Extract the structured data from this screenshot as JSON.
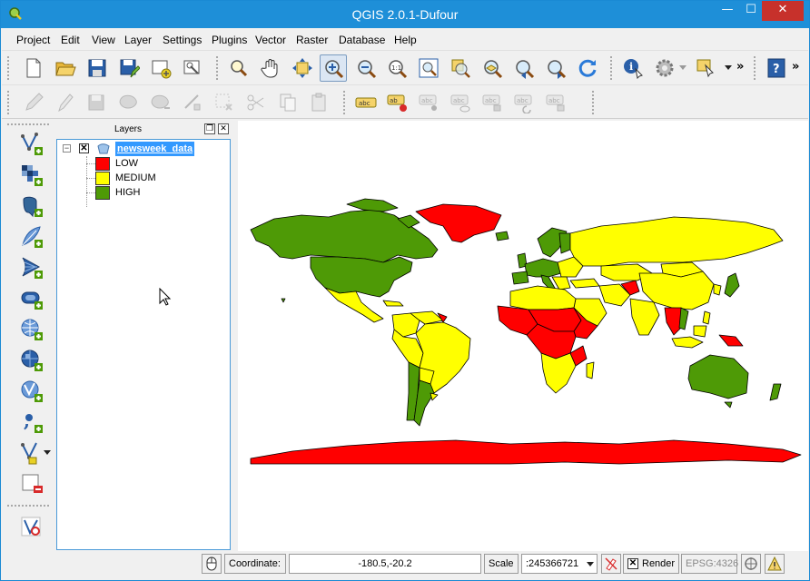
{
  "window": {
    "title": "QGIS 2.0.1-Dufour",
    "minimize": "—",
    "maximize": "☐",
    "close": "✕"
  },
  "menu": [
    {
      "label": "Project"
    },
    {
      "label": "Edit"
    },
    {
      "label": "View"
    },
    {
      "label": "Layer"
    },
    {
      "label": "Settings"
    },
    {
      "label": "Plugins"
    },
    {
      "label": "Vector"
    },
    {
      "label": "Raster"
    },
    {
      "label": "Database"
    },
    {
      "label": "Help"
    }
  ],
  "toolbar1_icons": [
    "new-project-icon",
    "open-project-icon",
    "save-project-icon",
    "save-as-icon",
    "new-print-composer-icon",
    "composer-manager-icon",
    "touch-zoom-icon",
    "pan-icon",
    "pan-to-selection-icon",
    "zoom-in-icon",
    "zoom-out-icon",
    "zoom-actual-size-icon",
    "zoom-full-icon",
    "zoom-to-selection-icon",
    "zoom-to-layer-icon",
    "zoom-last-icon",
    "zoom-next-icon",
    "refresh-icon",
    "identify-icon",
    "run-action-icon",
    "select-features-icon",
    "help-icon"
  ],
  "toolbar2_icons": [
    "current-edits-icon",
    "toggle-editing-icon",
    "save-edits-icon",
    "add-feature-icon",
    "move-feature-icon",
    "node-tool-icon",
    "delete-selected-icon",
    "cut-features-icon",
    "copy-features-icon",
    "paste-features-icon",
    "label-icon",
    "label-pin-icon",
    "label-move-icon",
    "label-show-hide-icon",
    "label-rotate-icon",
    "label-change-icon",
    "label-properties-icon"
  ],
  "left_toolbar_icons": [
    "add-vector-layer-icon",
    "add-raster-layer-icon",
    "add-postgis-layer-icon",
    "add-spatialite-layer-icon",
    "add-mssql-layer-icon",
    "add-oracle-layer-icon",
    "add-wms-layer-icon",
    "add-wcs-layer-icon",
    "add-wfs-layer-icon",
    "add-delimited-text-layer-icon",
    "new-shapefile-layer-icon",
    "remove-layer-icon",
    "georeferencer-icon"
  ],
  "layers_panel": {
    "title": "Layers",
    "layer": {
      "name": "newsweek_data",
      "checked": "✕",
      "collapse": "−"
    },
    "legend": [
      {
        "label": "LOW",
        "color": "#ff0000"
      },
      {
        "label": "MEDIUM",
        "color": "#ffff00"
      },
      {
        "label": "HIGH",
        "color": "#4e9a06"
      }
    ]
  },
  "colors": {
    "titlebar": "#1e8fd8",
    "selection": "#3399ff",
    "low": "#ff0000",
    "medium": "#ffff00",
    "high": "#4e9a06"
  },
  "statusbar": {
    "coordinate_label": "Coordinate:",
    "coordinate_value": "-180.5,-20.2",
    "scale_label": "Scale",
    "scale_value": ":245366721",
    "render_checked": "✕",
    "render_label": "Render",
    "crs_label": "EPSG:4326"
  }
}
